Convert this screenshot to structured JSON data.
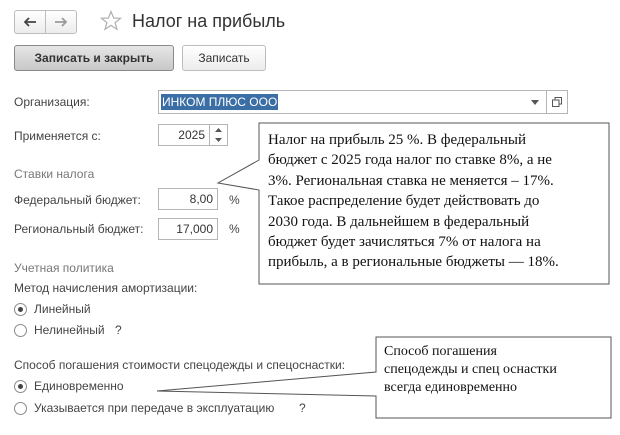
{
  "header": {
    "title": "Налог на прибыль",
    "back_icon": "arrow-left-icon",
    "forward_icon": "arrow-right-icon",
    "favorite_icon": "star-outline-icon"
  },
  "toolbar": {
    "save_close_label": "Записать и закрыть",
    "save_label": "Записать"
  },
  "form": {
    "organization_label": "Организация:",
    "organization_value": "ИНКОМ ПЛЮС ООО",
    "applies_label": "Применяется с:",
    "applies_value": "2025",
    "rates_group": "Ставки налога",
    "federal_label": "Федеральный бюджет:",
    "federal_value": "8,00",
    "federal_unit": "%",
    "regional_label": "Региональный бюджет:",
    "regional_value": "17,000",
    "regional_unit": "%",
    "policy_group": "Учетная политика",
    "depreciation_label": "Метод начисления амортизации:",
    "depreciation_options": [
      "Линейный",
      "Нелинейный",
      "?"
    ],
    "depreciation_selected": "Линейный",
    "workwear_label": "Способ погашения стоимости спецодежды и спецоснастки:",
    "workwear_options": [
      "Единовременно",
      "Указывается при передаче в эксплуатацию",
      "?"
    ],
    "workwear_selected": "Единовременно"
  },
  "callouts": {
    "rates_note_lines": [
      "Налог на прибыль 25 %. В федеральный",
      "бюджет с 2025 года налог по ставке 8%, а не",
      "3%. Региональная ставка не меняется – 17%.",
      "Такое распределение будет действовать до",
      "2030 года. В дальнейшем в федеральный",
      "бюджет будет зачисляться 7% от налога на",
      "прибыль, а в региональные бюджеты — 18%."
    ],
    "workwear_note_lines": [
      "Способ погашения",
      "спецодежды и спец оснастки",
      "всегда единовременно"
    ]
  },
  "colors": {
    "selection": "#3b6ea5",
    "primary_button_top": "#e6e6e6",
    "primary_button_bottom": "#c8c8c8"
  }
}
